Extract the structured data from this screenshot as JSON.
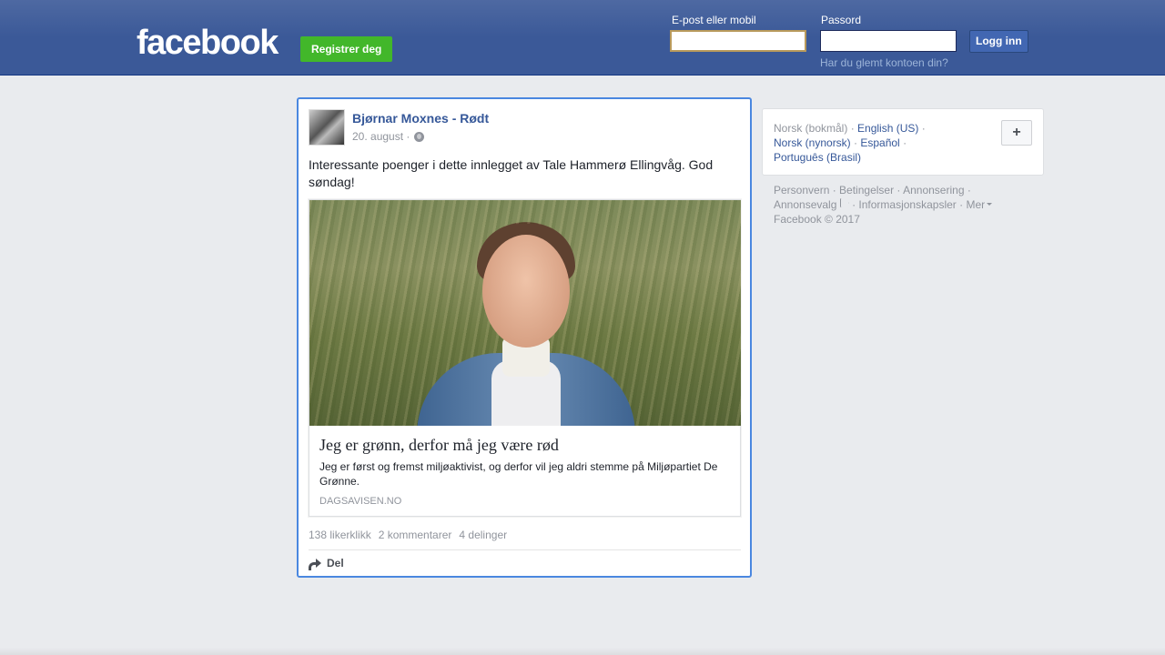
{
  "header": {
    "logo": "facebook",
    "register_label": "Registrer deg",
    "email_label": "E-post eller mobil",
    "email_value": "",
    "password_label": "Passord",
    "password_value": "",
    "login_label": "Logg inn",
    "forgot_label": "Har du glemt kontoen din?"
  },
  "post": {
    "author": "Bjørnar Moxnes - Rødt",
    "date": "20. august ·",
    "privacy_icon": "globe-icon",
    "text": "Interessante poenger i dette innlegget av Tale Hammerø Ellingvåg. God søndag!",
    "link": {
      "title": "Jeg er grønn, derfor må jeg være rød",
      "description": "Jeg er først og fremst miljøaktivist, og derfor vil jeg aldri stemme på Miljøpartiet De Grønne.",
      "domain": "DAGSAVISEN.NO"
    },
    "stats": {
      "likes": "138 likerklikk",
      "comments": "2 kommentarer",
      "shares": "4 delinger"
    },
    "share_label": "Del"
  },
  "languages": {
    "current": "Norsk (bokmål)",
    "options": [
      "English (US)",
      "Norsk (nynorsk)",
      "Español",
      "Português (Brasil)"
    ],
    "add_icon": "plus-icon"
  },
  "footer": {
    "links": [
      "Personvern",
      "Betingelser",
      "Annonsering",
      "Annonsevalg",
      "Informasjonskapsler",
      "Mer"
    ],
    "copyright": "Facebook © 2017"
  },
  "colors": {
    "header_bg": "#3b5998",
    "register_green": "#42b72a",
    "link_blue": "#365899",
    "focus_border": "#4a87e0"
  }
}
